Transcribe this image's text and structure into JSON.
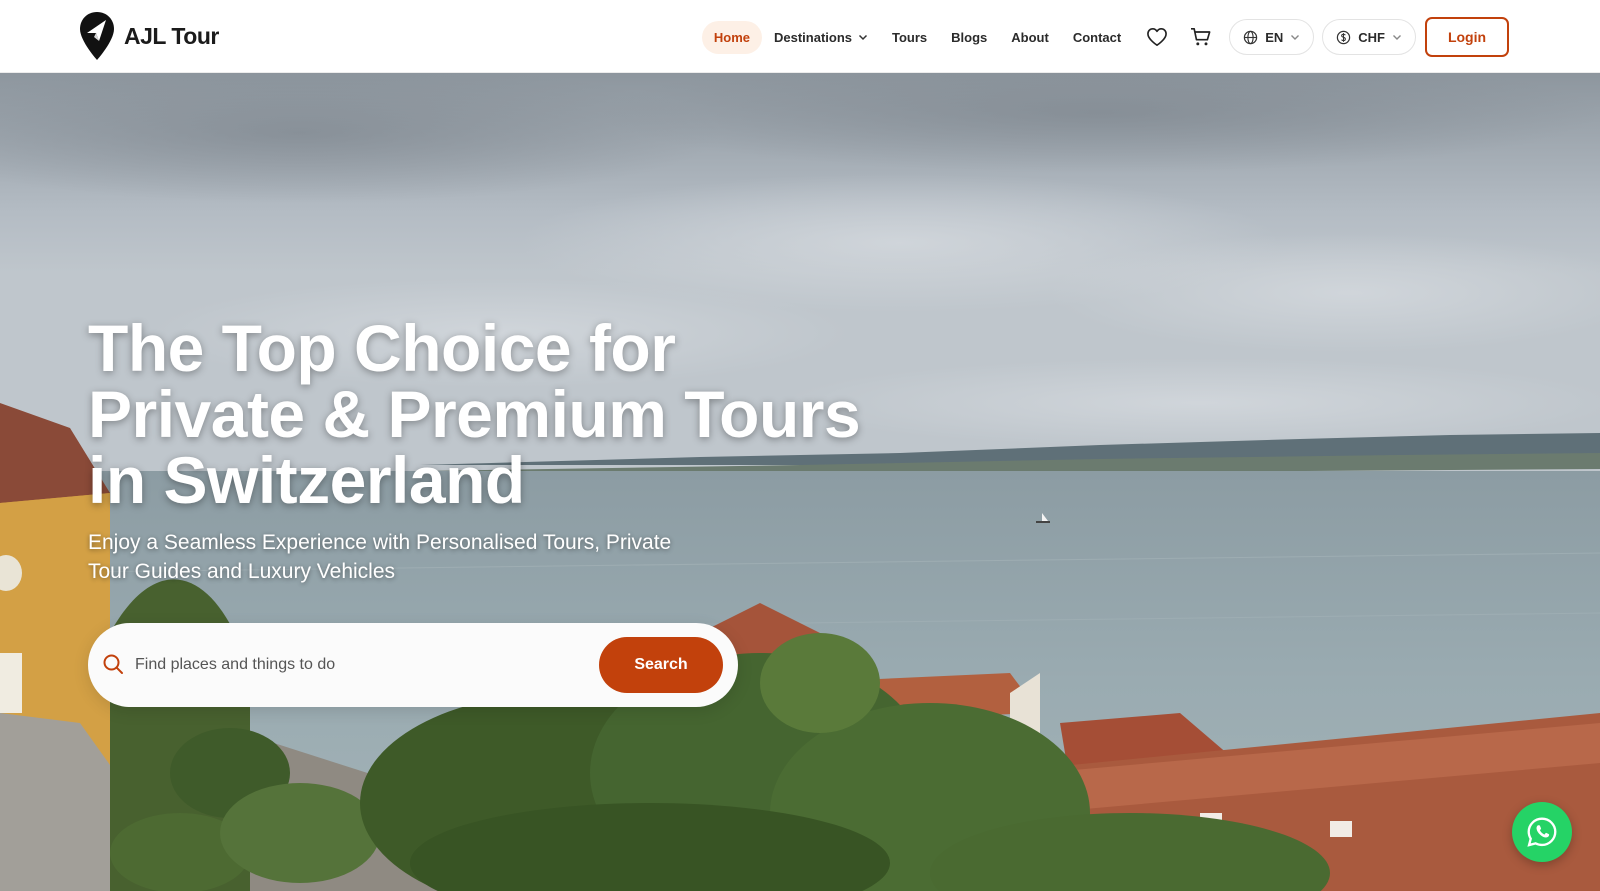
{
  "brand": {
    "name": "AJL Tour",
    "logo_icon": "map-pin-plane-icon",
    "accent_color": "#c2410c"
  },
  "nav": {
    "home": "Home",
    "destinations": "Destinations",
    "tours": "Tours",
    "blogs": "Blogs",
    "about": "About",
    "contact": "Contact",
    "wishlist_icon": "heart-icon",
    "cart_icon": "cart-icon",
    "language": "EN",
    "currency": "CHF",
    "login": "Login"
  },
  "hero": {
    "title": "The Top Choice for Private & Premium Tours in Switzerland",
    "subtitle": "Enjoy a Seamless Experience with Personalised Tours, Private Tour Guides and Luxury Vehicles",
    "search": {
      "placeholder": "Find places and things to do",
      "value": "",
      "button": "Search"
    }
  },
  "floating": {
    "whatsapp_icon": "whatsapp-icon",
    "whatsapp_color": "#25d366"
  }
}
